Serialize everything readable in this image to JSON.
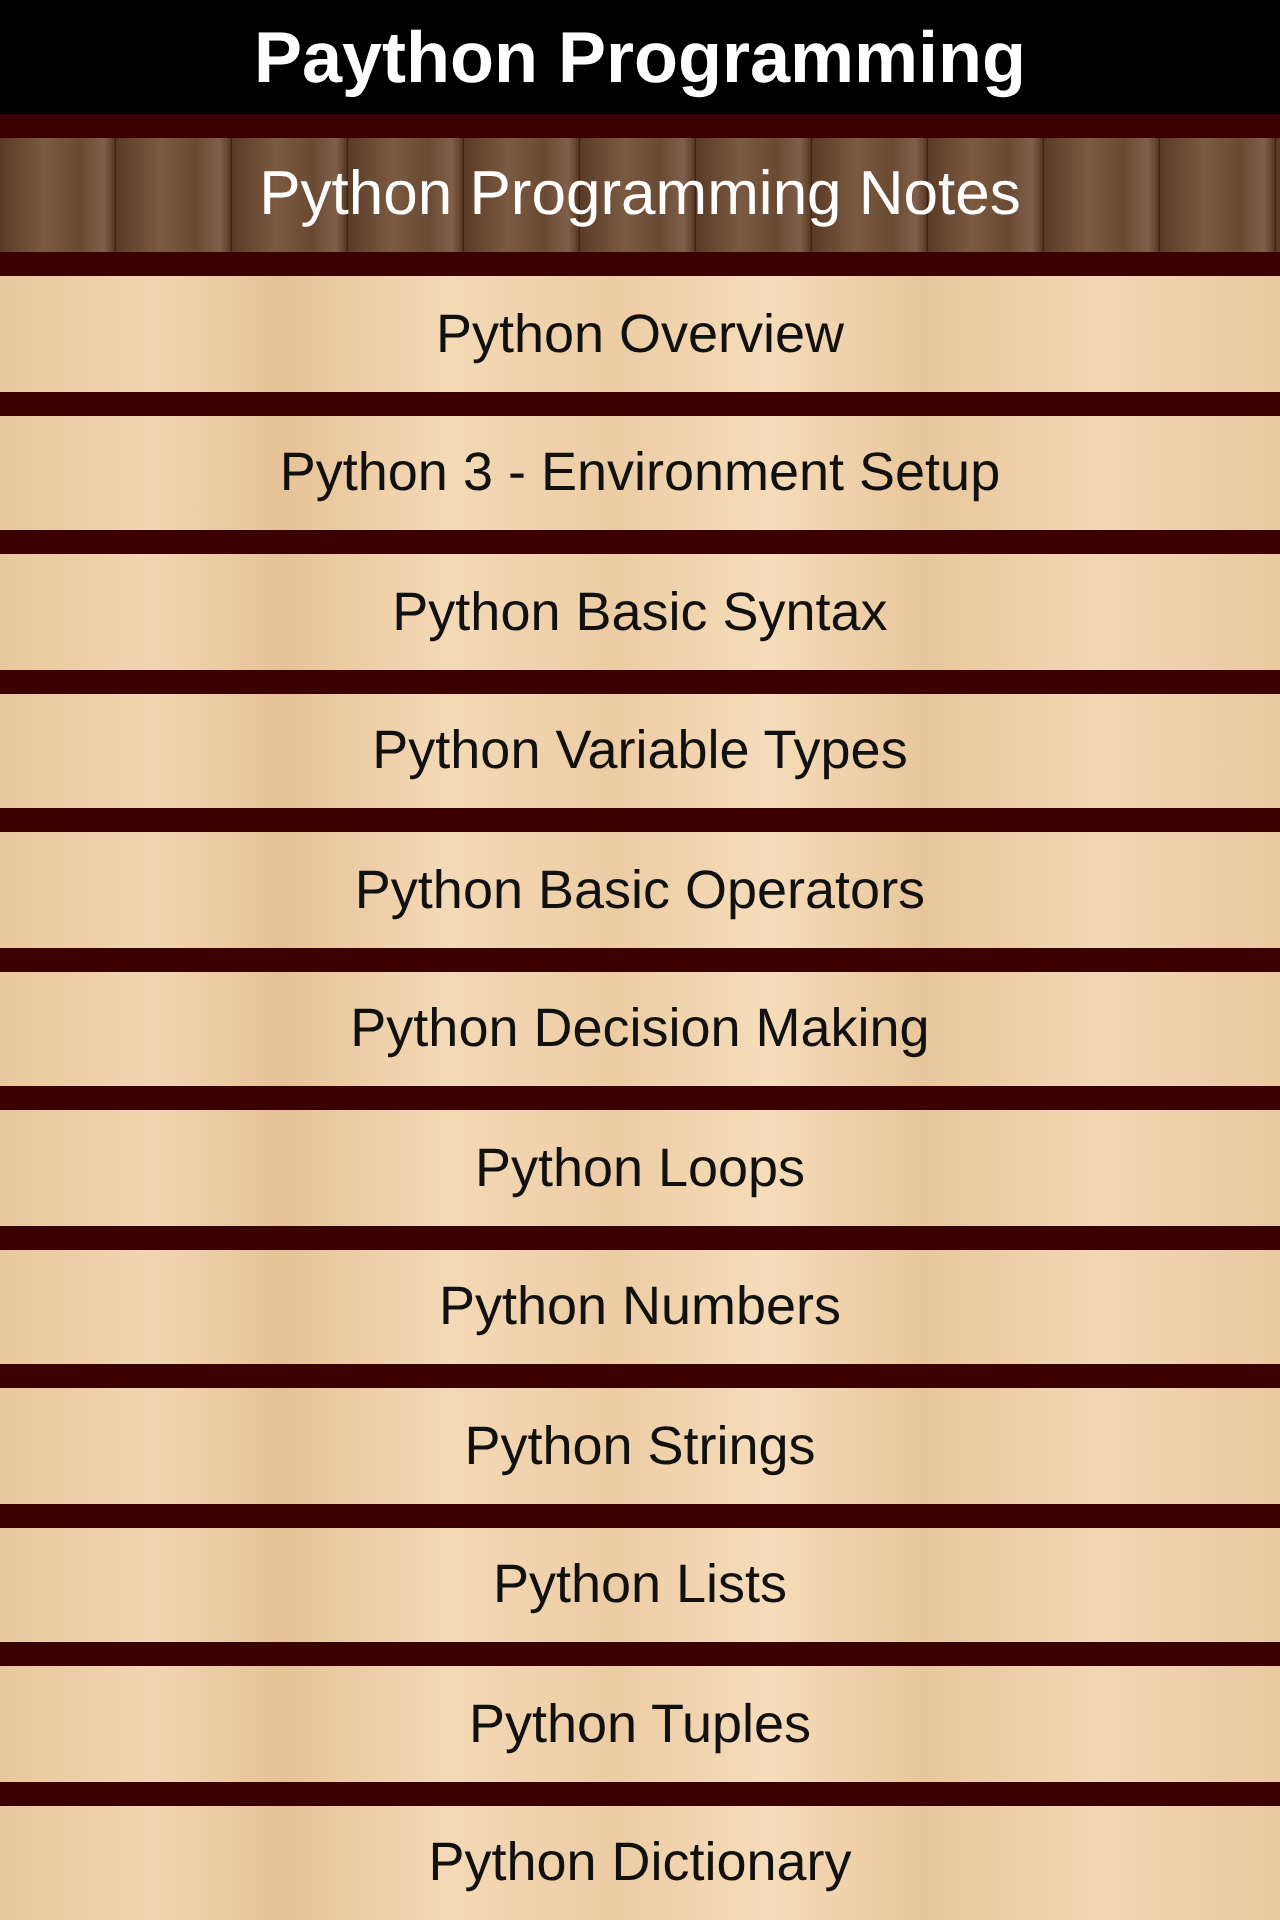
{
  "title": "Paython Programming",
  "menu": {
    "header": "Python Programming Notes",
    "items": [
      "Python Overview",
      "Python 3 - Environment Setup",
      "Python Basic Syntax",
      "Python Variable Types",
      "Python Basic Operators",
      "Python Decision Making",
      "Python Loops",
      "Python Numbers",
      "Python Strings",
      "Python Lists",
      "Python Tuples",
      "Python Dictionary"
    ]
  }
}
